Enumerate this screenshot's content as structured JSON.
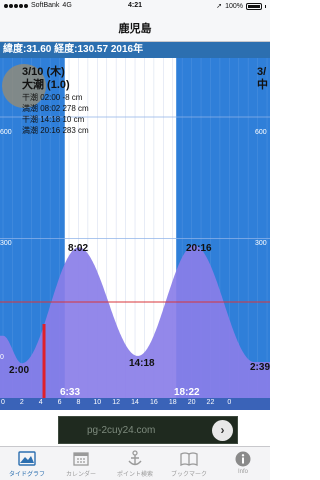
{
  "status_bar": {
    "carrier": "SoftBank",
    "network": "4G",
    "time": "4:21",
    "battery": "100%"
  },
  "nav": {
    "title": "鹿児島"
  },
  "info": {
    "coords": "緯度:31.60 経度:130.57  2016年"
  },
  "day": {
    "date": "3/10 (木)",
    "tide_type": "大潮 (1.0)",
    "entries": [
      "干潮 02:00  -8 cm",
      "満潮 08:02 278 cm",
      "干潮 14:18  10 cm",
      "満潮 20:16 283 cm"
    ]
  },
  "next_day": {
    "date": "3/",
    "tide_type": "中"
  },
  "chart": {
    "y_labels": [
      "600",
      "600",
      "300",
      "300",
      "0"
    ],
    "hour_ticks": [
      "0",
      "2",
      "4",
      "6",
      "8",
      "10",
      "12",
      "14",
      "16",
      "18",
      "20",
      "22",
      "0"
    ],
    "tide_labels": {
      "high1": "8:02",
      "high2": "20:16",
      "low1": "2:00",
      "low2": "14:18",
      "low3": "2:39"
    },
    "sun": {
      "sunrise": "6:33",
      "sunset": "18:22"
    },
    "colors": {
      "tide_fill": "#8a7ee8",
      "night": "#2f7fd9",
      "day": "#ffffff",
      "now_line": "#e0202a"
    }
  },
  "chart_data": {
    "type": "area",
    "title": "",
    "xlabel": "",
    "ylabel": "",
    "x": [
      0,
      2.0,
      8.03,
      14.3,
      20.27,
      26.65
    ],
    "series": [
      {
        "values": [
          60,
          -8,
          278,
          10,
          283,
          -5
        ]
      }
    ],
    "ylim": [
      0,
      600
    ]
  },
  "ad": {
    "text": "pg-2cuy24.com"
  },
  "tabs": [
    {
      "label": "タイドグラフ",
      "icon": "tide-graph-icon",
      "active": true
    },
    {
      "label": "カレンダー",
      "icon": "calendar-icon",
      "active": false
    },
    {
      "label": "ポイント検索",
      "icon": "anchor-icon",
      "active": false
    },
    {
      "label": "ブックマーク",
      "icon": "book-icon",
      "active": false
    },
    {
      "label": "Info",
      "icon": "info-icon",
      "active": false
    }
  ]
}
